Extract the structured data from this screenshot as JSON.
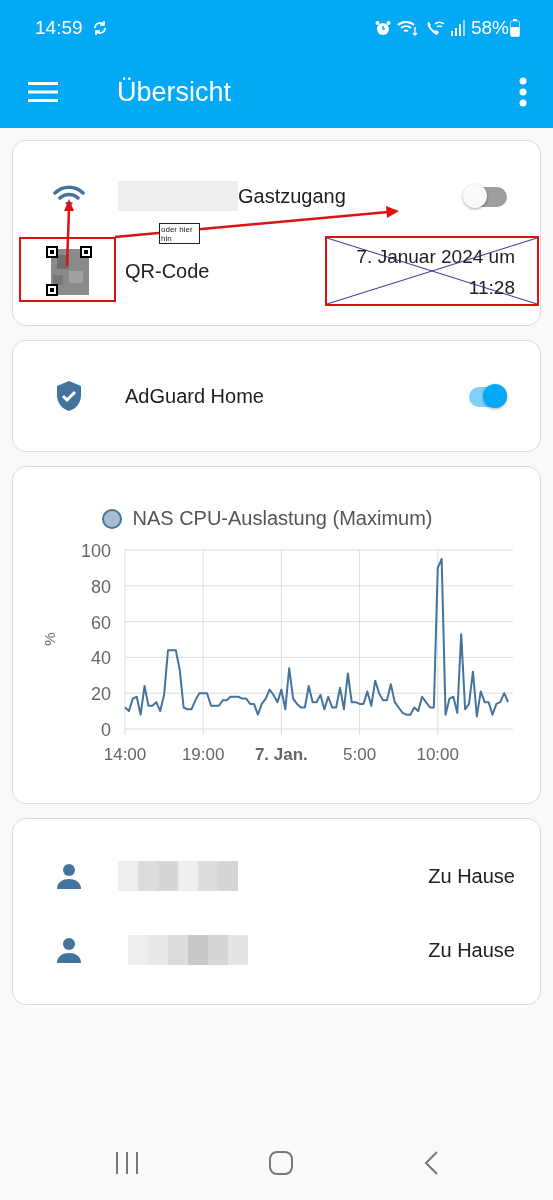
{
  "status_bar": {
    "time": "14:59",
    "battery": "58%"
  },
  "app_bar": {
    "title": "Übersicht"
  },
  "guest_card": {
    "name": "Gastzugang",
    "on": false,
    "qr_label": "QR-Code",
    "timestamp": "7. Januar 2024 um 11:28",
    "note": "oder hier hin"
  },
  "adguard_card": {
    "name": "AdGuard Home",
    "on": true
  },
  "chart_card": {
    "chart_data": {
      "type": "line",
      "grid": true,
      "ylabel": "%",
      "ylim": [
        0,
        100
      ],
      "yticks": [
        0,
        20,
        40,
        60,
        80,
        100
      ],
      "categories": [
        "14:00",
        null,
        null,
        null,
        null,
        null,
        null,
        null,
        null,
        null,
        null,
        null,
        null,
        null,
        null,
        null,
        null,
        null,
        null,
        null,
        "19:00",
        null,
        null,
        null,
        null,
        null,
        null,
        null,
        null,
        null,
        null,
        null,
        null,
        null,
        null,
        null,
        null,
        null,
        null,
        null,
        "**7. Jan.**",
        null,
        null,
        null,
        null,
        null,
        null,
        null,
        null,
        null,
        null,
        null,
        null,
        null,
        null,
        null,
        null,
        null,
        null,
        null,
        "5:00",
        null,
        null,
        null,
        null,
        null,
        null,
        null,
        null,
        null,
        null,
        null,
        null,
        null,
        null,
        null,
        null,
        null,
        null,
        null,
        "10:00",
        null,
        null,
        null,
        null,
        null,
        null,
        null,
        null,
        null,
        null,
        null,
        null,
        null,
        null,
        null,
        null,
        null,
        null
      ],
      "series": [
        {
          "name": "NAS CPU-Auslastung (Maximum)",
          "color": "#44739e",
          "values": [
            12,
            10,
            17,
            18,
            8,
            24,
            13,
            13,
            15,
            10,
            19,
            44,
            44,
            44,
            33,
            12,
            11,
            11,
            16,
            20,
            20,
            20,
            13,
            13,
            13,
            16,
            16,
            18,
            18,
            18,
            17,
            17,
            14,
            14,
            8,
            14,
            17,
            22,
            19,
            15,
            22,
            11,
            34,
            17,
            14,
            12,
            12,
            24,
            15,
            15,
            19,
            11,
            18,
            12,
            12,
            23,
            11,
            31,
            15,
            15,
            14,
            14,
            21,
            13,
            27,
            20,
            16,
            16,
            25,
            15,
            12,
            9,
            8,
            8,
            12,
            10,
            18,
            15,
            12,
            12,
            90,
            95,
            8,
            17,
            18,
            9,
            53,
            11,
            14,
            32,
            7,
            21,
            15,
            15,
            8,
            14,
            15,
            20,
            15
          ]
        }
      ]
    }
  },
  "persons": [
    {
      "state": "Zu Hause"
    },
    {
      "state": "Zu Hause"
    }
  ]
}
